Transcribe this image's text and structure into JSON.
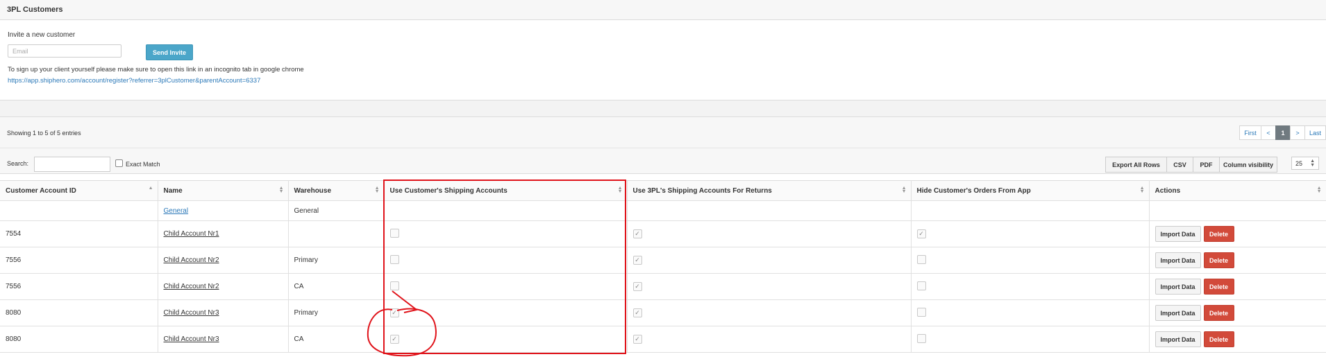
{
  "page": {
    "title": "3PL Customers"
  },
  "invite": {
    "label": "Invite a new customer",
    "email_placeholder": "Email",
    "send_button": "Send Invite",
    "note": "To sign up your client yourself please make sure to open this link in an incognito tab in google chrome",
    "link": "https://app.shiphero.com/account/register?referrer=3plCustomer&parentAccount=6337"
  },
  "table_info": {
    "showing": "Showing 1 to 5 of 5 entries"
  },
  "pagination": {
    "first": "First",
    "prev": "<",
    "current": "1",
    "next": ">",
    "last": "Last"
  },
  "search": {
    "label": "Search:",
    "value": "",
    "exact_match": "Exact Match"
  },
  "export": {
    "all_rows": "Export All Rows",
    "csv": "CSV",
    "pdf": "PDF",
    "column_visibility": "Column visibility"
  },
  "page_size": "25",
  "columns": {
    "account_id": "Customer Account ID",
    "name": "Name",
    "warehouse": "Warehouse",
    "use_customer_shipping": "Use Customer's Shipping Accounts",
    "use_3pl_returns": "Use 3PL's Shipping Accounts For Returns",
    "hide_orders": "Hide Customer's Orders From App",
    "actions": "Actions"
  },
  "general_row": {
    "name": "General",
    "warehouse": "General"
  },
  "rows": [
    {
      "account_id": "7554",
      "name": "Child Account Nr1",
      "warehouse": "",
      "use_customer_shipping": false,
      "use_3pl_returns": true,
      "hide_orders": true
    },
    {
      "account_id": "7556",
      "name": "Child Account Nr2",
      "warehouse": "Primary",
      "use_customer_shipping": false,
      "use_3pl_returns": true,
      "hide_orders": false
    },
    {
      "account_id": "7556",
      "name": "Child Account Nr2",
      "warehouse": "CA",
      "use_customer_shipping": false,
      "use_3pl_returns": true,
      "hide_orders": false
    },
    {
      "account_id": "8080",
      "name": "Child Account Nr3",
      "warehouse": "Primary",
      "use_customer_shipping": true,
      "use_3pl_returns": true,
      "hide_orders": false
    },
    {
      "account_id": "8080",
      "name": "Child Account Nr3",
      "warehouse": "CA",
      "use_customer_shipping": true,
      "use_3pl_returns": true,
      "hide_orders": false
    }
  ],
  "row_actions": {
    "import": "Import Data",
    "delete": "Delete"
  },
  "colors": {
    "accent": "#4ba6c9",
    "danger": "#d24a3a",
    "link": "#2a78b8",
    "annotation": "#e0131a"
  }
}
